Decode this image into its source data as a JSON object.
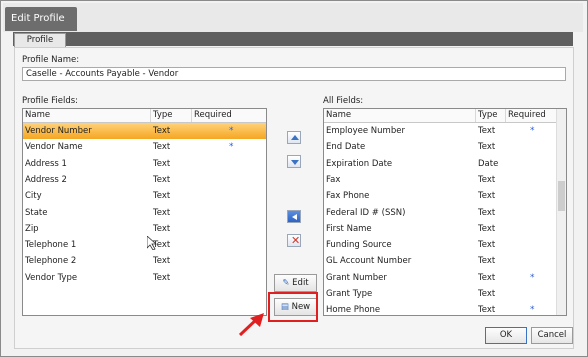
{
  "window": {
    "title": "Edit Profile"
  },
  "tabs": [
    {
      "label": "Profile"
    }
  ],
  "profile_name": {
    "label": "Profile Name:",
    "value": "Caselle - Accounts Payable - Vendor"
  },
  "profile_fields": {
    "label": "Profile Fields:",
    "headers": {
      "name": "Name",
      "type": "Type",
      "required": "Required"
    },
    "rows": [
      {
        "name": "Vendor Number",
        "type": "Text",
        "required": "*",
        "selected": true
      },
      {
        "name": "Vendor Name",
        "type": "Text",
        "required": "*"
      },
      {
        "name": "Address 1",
        "type": "Text",
        "required": ""
      },
      {
        "name": "Address 2",
        "type": "Text",
        "required": ""
      },
      {
        "name": "City",
        "type": "Text",
        "required": ""
      },
      {
        "name": "State",
        "type": "Text",
        "required": ""
      },
      {
        "name": "Zip",
        "type": "Text",
        "required": ""
      },
      {
        "name": "Telephone 1",
        "type": "Text",
        "required": ""
      },
      {
        "name": "Telephone 2",
        "type": "Text",
        "required": ""
      },
      {
        "name": "Vendor Type",
        "type": "Text",
        "required": ""
      }
    ]
  },
  "all_fields": {
    "label": "All Fields:",
    "headers": {
      "name": "Name",
      "type": "Type",
      "required": "Required"
    },
    "rows": [
      {
        "name": "Employee Number",
        "type": "Text",
        "required": "*"
      },
      {
        "name": "End Date",
        "type": "Text",
        "required": ""
      },
      {
        "name": "Expiration Date",
        "type": "Date",
        "required": ""
      },
      {
        "name": "Fax",
        "type": "Text",
        "required": ""
      },
      {
        "name": "Fax Phone",
        "type": "Text",
        "required": ""
      },
      {
        "name": "Federal ID # (SSN)",
        "type": "Text",
        "required": ""
      },
      {
        "name": "First Name",
        "type": "Text",
        "required": ""
      },
      {
        "name": "Funding Source",
        "type": "Text",
        "required": ""
      },
      {
        "name": "GL Account Number",
        "type": "Text",
        "required": ""
      },
      {
        "name": "Grant Number",
        "type": "Text",
        "required": "*"
      },
      {
        "name": "Grant Type",
        "type": "Text",
        "required": ""
      },
      {
        "name": "Home Phone",
        "type": "Text",
        "required": "*"
      }
    ]
  },
  "buttons": {
    "edit": "Edit",
    "new": "New",
    "ok": "OK",
    "cancel": "Cancel"
  },
  "colors": {
    "selection": "#f5a623",
    "required_star": "#2b5fd9",
    "highlight": "#e02020",
    "tab_bar": "#5f5f5f"
  }
}
